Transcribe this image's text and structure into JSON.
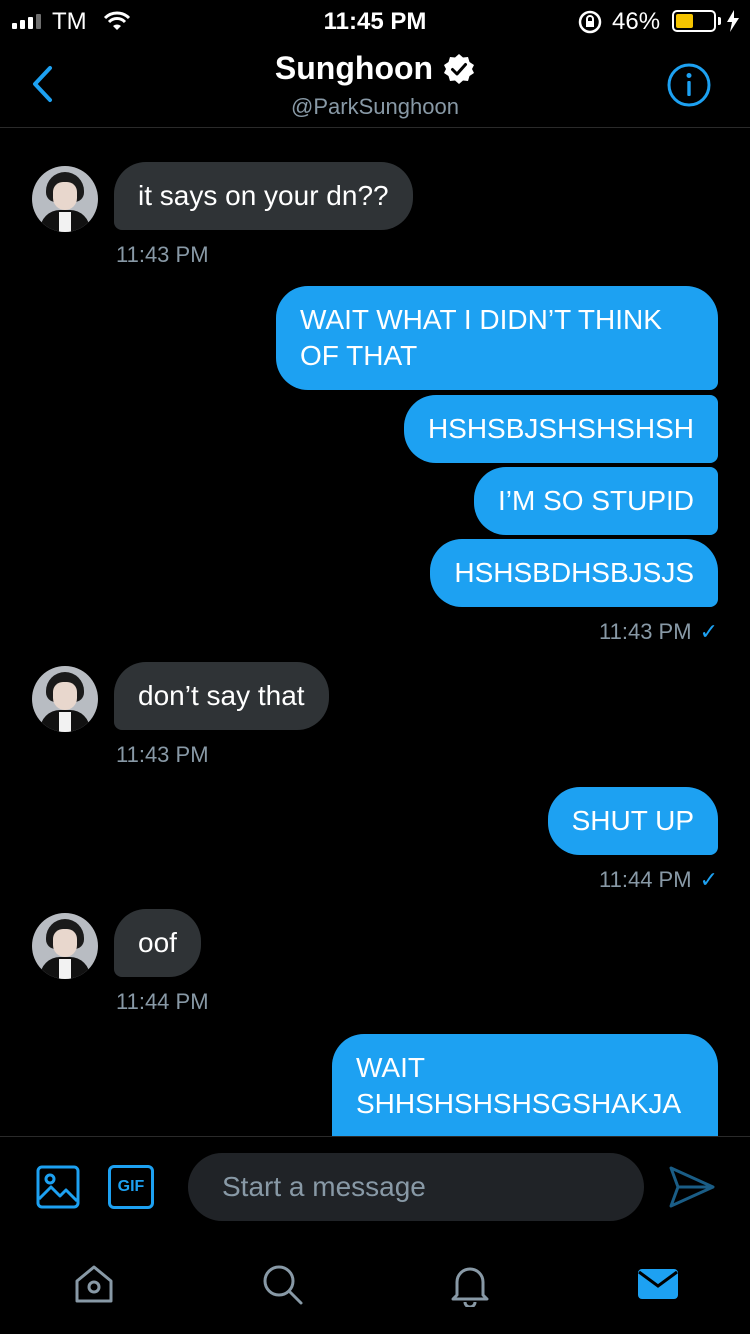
{
  "status_bar": {
    "carrier": "TM",
    "time": "11:45 PM",
    "battery_percent_label": "46%",
    "battery_level": 0.46,
    "battery_color": "#f5c400"
  },
  "header": {
    "back_icon": "chevron-left-icon",
    "title": "Sunghoon",
    "verified_icon": "verified-badge-icon",
    "handle": "@ParkSunghoon",
    "info_icon": "info-icon"
  },
  "messages": [
    {
      "direction": "incoming",
      "text": "it says on your dn??",
      "time": "11:43 PM"
    },
    {
      "direction": "outgoing",
      "text": "WAIT WHAT I DIDN’T THINK OF THAT"
    },
    {
      "direction": "outgoing",
      "text": "HSHSBJSHSHSHSH"
    },
    {
      "direction": "outgoing",
      "text": "I’M SO STUPID"
    },
    {
      "direction": "outgoing",
      "text": "HSHSBDHSBJSJS",
      "time": "11:43 PM",
      "read": "✓"
    },
    {
      "direction": "incoming",
      "text": "don’t say that",
      "time": "11:43 PM"
    },
    {
      "direction": "outgoing",
      "text": "SHUT UP",
      "time": "11:44 PM",
      "read": "✓"
    },
    {
      "direction": "incoming",
      "text": "oof",
      "time": "11:44 PM"
    },
    {
      "direction": "outgoing",
      "text": "WAIT SHHSHSHSHSGSHAKJA"
    }
  ],
  "composer": {
    "image_icon": "image-icon",
    "gif_label": "GIF",
    "placeholder": "Start a message",
    "send_icon": "send-icon"
  },
  "tabbar": {
    "tabs": [
      "home-icon",
      "search-icon",
      "notifications-icon",
      "messages-icon"
    ],
    "active": "messages-icon"
  },
  "colors": {
    "accent": "#1da1f2",
    "incoming_bubble": "#2f3336",
    "muted_text": "#8899a6",
    "background": "#000000"
  }
}
